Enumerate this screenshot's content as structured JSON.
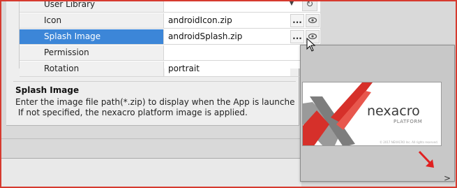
{
  "properties": [
    {
      "name": "User Library",
      "value": "",
      "control": "dropdown-refresh"
    },
    {
      "name": "Icon",
      "value": "androidIcon.zip",
      "control": "file"
    },
    {
      "name": "Splash Image",
      "value": "androidSplash.zip",
      "control": "file",
      "selected": true
    },
    {
      "name": "Permission",
      "value": "",
      "control": "none"
    },
    {
      "name": "Rotation",
      "value": "portrait",
      "control": "none"
    }
  ],
  "description": {
    "title": "Splash Image",
    "line1": "Enter the image file path(*.zip) to display when the App is launche",
    "line2": " If not specified, the nexacro platform image is applied."
  },
  "buttons": {
    "browse_label": "...",
    "refresh_glyph": "↻",
    "dropdown_glyph": "▼"
  },
  "preview": {
    "logo_text": "nexacro",
    "logo_subtext": "PLATFORM",
    "copyright": "© 2017 NEXACRO Inc. All rights reserved.",
    "next_glyph": ">"
  },
  "colors": {
    "selected_row": "#3c86d8",
    "logo_red": "#d6302a",
    "logo_gray": "#8c8c8c",
    "annotation_red": "#e02020"
  }
}
